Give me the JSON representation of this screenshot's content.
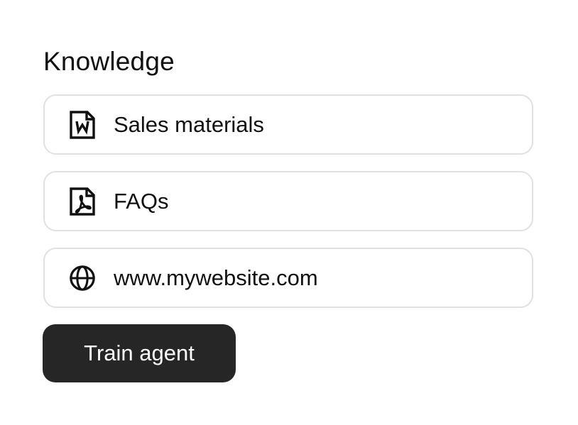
{
  "knowledge": {
    "title": "Knowledge",
    "items": [
      {
        "label": "Sales materials",
        "icon": "word-document-icon"
      },
      {
        "label": "FAQs",
        "icon": "pdf-document-icon"
      },
      {
        "label": "www.mywebsite.com",
        "icon": "globe-icon"
      }
    ]
  },
  "actions": {
    "train_label": "Train agent"
  },
  "colors": {
    "button_background": "#262626",
    "button_text": "#ffffff",
    "card_border": "#e1e1e1",
    "text": "#111111"
  }
}
